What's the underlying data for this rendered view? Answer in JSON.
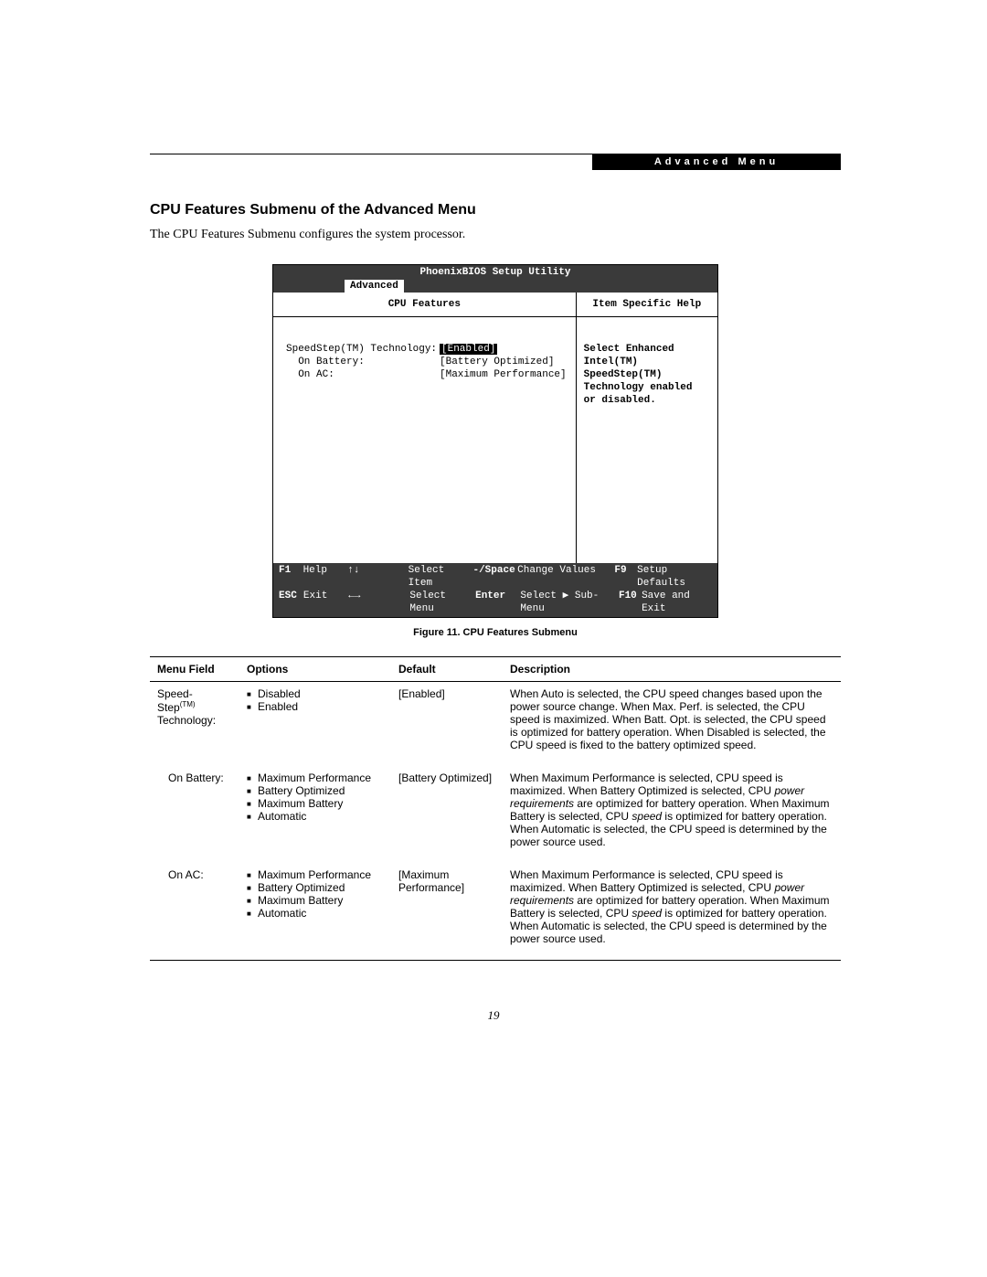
{
  "header_bar": "Advanced Menu",
  "heading": "CPU Features Submenu of the Advanced Menu",
  "intro": "The CPU Features Submenu configures the system processor.",
  "bios": {
    "utility_title": "PhoenixBIOS Setup Utility",
    "active_tab": "Advanced",
    "left_header": "CPU Features",
    "right_header": "Item Specific Help",
    "settings": {
      "row1_label": "SpeedStep(TM) Technology:",
      "row1_value": "[Enabled]",
      "row2_label": "  On Battery:",
      "row2_value": "[Battery Optimized]",
      "row3_label": "  On AC:",
      "row3_value": "[Maximum Performance]"
    },
    "help_text": "Select Enhanced Intel(TM) SpeedStep(TM) Technology enabled or disabled.",
    "footer": {
      "r1": {
        "k1": "F1",
        "a1": "Help",
        "k2": "↑↓",
        "a2": "Select Item",
        "k3": "-/Space",
        "a3": "Change Values",
        "k4": "F9",
        "a4": "Setup Defaults"
      },
      "r2": {
        "k1": "ESC",
        "a1": "Exit",
        "k2": "←→",
        "a2": "Select Menu",
        "k3": "Enter",
        "a3": "Select ▶ Sub-Menu",
        "k4": "F10",
        "a4": "Save and Exit"
      }
    }
  },
  "figure_caption": "Figure 11.   CPU Features Submenu",
  "table": {
    "headers": {
      "menu_field": "Menu Field",
      "options": "Options",
      "def": "Default",
      "desc": "Description"
    },
    "rows": [
      {
        "menu_field_line1": "Speed-",
        "menu_field_line2": "Step",
        "menu_field_sup": "(TM)",
        "menu_field_line3": "Technology:",
        "menu_indent": false,
        "options": [
          "Disabled",
          "Enabled"
        ],
        "def": "[Enabled]",
        "desc": "When Auto is selected, the CPU speed changes based upon the power source change. When Max. Perf. is selected, the CPU speed is maximized. When Batt. Opt. is selected, the CPU speed is optimized for battery operation. When Disabled is selected, the CPU speed is fixed to the battery optimized speed."
      },
      {
        "menu_field_line1": "On Battery:",
        "menu_indent": true,
        "options": [
          "Maximum Performance",
          "Battery Optimized",
          "Maximum Battery",
          "Automatic"
        ],
        "def": "[Battery Optimized]",
        "desc_parts": [
          "When Maximum Performance is selected, CPU speed is maximized. When Battery Optimized is selected, CPU ",
          "power requirements",
          " are optimized for battery operation. When Maximum Battery is selected, CPU ",
          "speed",
          " is optimized for battery operation. When Automatic is selected, the CPU speed is determined by the power source used."
        ]
      },
      {
        "menu_field_line1": "On AC:",
        "menu_indent": true,
        "options": [
          "Maximum Performance",
          "Battery Optimized",
          "Maximum Battery",
          "Automatic"
        ],
        "def": "[Maximum Performance]",
        "desc_parts": [
          "When Maximum Performance is selected, CPU speed is maximized. When Battery Optimized is selected, CPU ",
          "power requirements",
          " are optimized for battery operation. When Maximum Battery is selected, CPU ",
          "speed",
          " is optimized for battery operation. When Automatic is selected, the CPU speed is determined by the power source used."
        ]
      }
    ]
  },
  "page_number": "19"
}
